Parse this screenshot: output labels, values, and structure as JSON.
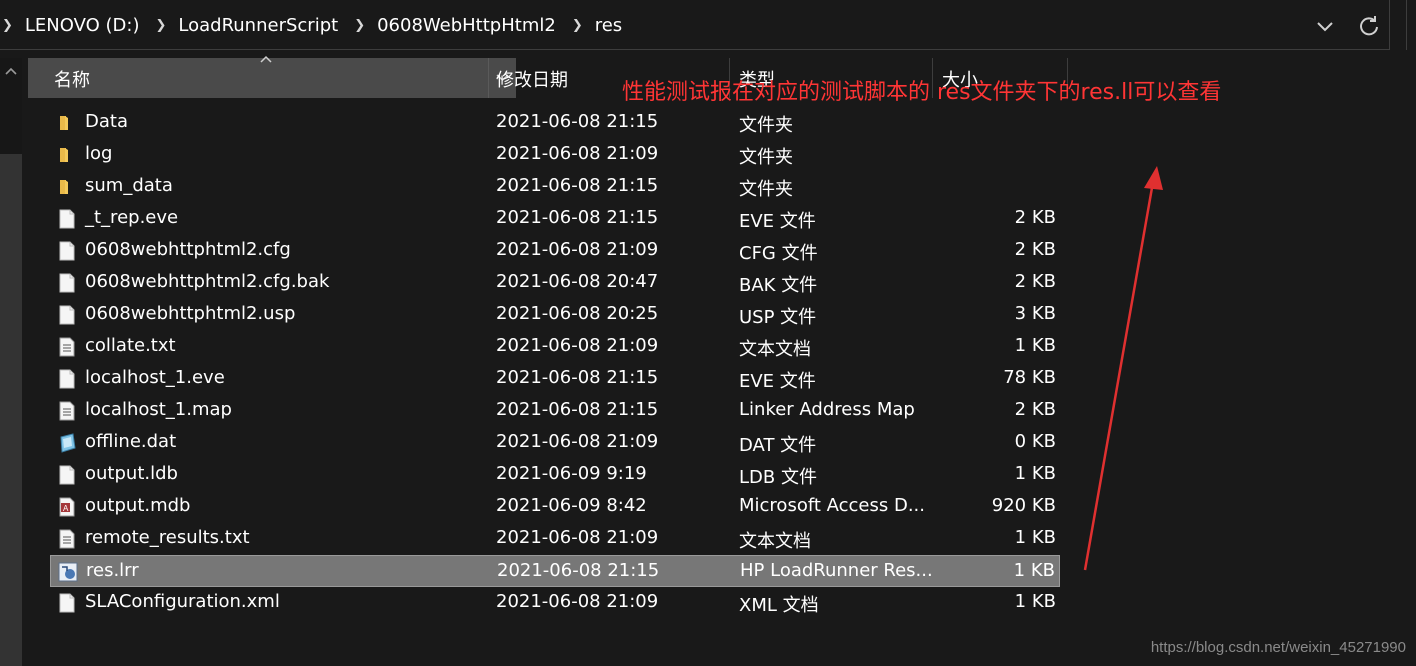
{
  "breadcrumb": [
    "LENOVO (D:)",
    "LoadRunnerScript",
    "0608WebHttpHtml2",
    "res"
  ],
  "columns": {
    "name": "名称",
    "date": "修改日期",
    "type": "类型",
    "size": "大小"
  },
  "files": [
    {
      "name": "Data",
      "date": "2021-06-08 21:15",
      "type": "文件夹",
      "size": "",
      "icon": "folder-icon"
    },
    {
      "name": "log",
      "date": "2021-06-08 21:09",
      "type": "文件夹",
      "size": "",
      "icon": "folder-icon"
    },
    {
      "name": "sum_data",
      "date": "2021-06-08 21:15",
      "type": "文件夹",
      "size": "",
      "icon": "folder-icon"
    },
    {
      "name": "_t_rep.eve",
      "date": "2021-06-08 21:15",
      "type": "EVE 文件",
      "size": "2 KB",
      "icon": "file-icon"
    },
    {
      "name": "0608webhttphtml2.cfg",
      "date": "2021-06-08 21:09",
      "type": "CFG 文件",
      "size": "2 KB",
      "icon": "file-icon"
    },
    {
      "name": "0608webhttphtml2.cfg.bak",
      "date": "2021-06-08 20:47",
      "type": "BAK 文件",
      "size": "2 KB",
      "icon": "file-icon"
    },
    {
      "name": "0608webhttphtml2.usp",
      "date": "2021-06-08 20:25",
      "type": "USP 文件",
      "size": "3 KB",
      "icon": "file-icon"
    },
    {
      "name": "collate.txt",
      "date": "2021-06-08 21:09",
      "type": "文本文档",
      "size": "1 KB",
      "icon": "text-file-icon"
    },
    {
      "name": "localhost_1.eve",
      "date": "2021-06-08 21:15",
      "type": "EVE 文件",
      "size": "78 KB",
      "icon": "file-icon"
    },
    {
      "name": "localhost_1.map",
      "date": "2021-06-08 21:15",
      "type": "Linker Address Map",
      "size": "2 KB",
      "icon": "text-file-icon"
    },
    {
      "name": "offline.dat",
      "date": "2021-06-08 21:09",
      "type": "DAT 文件",
      "size": "0 KB",
      "icon": "dat-file-icon"
    },
    {
      "name": "output.ldb",
      "date": "2021-06-09 9:19",
      "type": "LDB 文件",
      "size": "1 KB",
      "icon": "file-icon"
    },
    {
      "name": "output.mdb",
      "date": "2021-06-09 8:42",
      "type": "Microsoft Access D...",
      "size": "920 KB",
      "icon": "access-db-icon"
    },
    {
      "name": "remote_results.txt",
      "date": "2021-06-08 21:09",
      "type": "文本文档",
      "size": "1 KB",
      "icon": "text-file-icon"
    },
    {
      "name": "res.lrr",
      "date": "2021-06-08 21:15",
      "type": "HP LoadRunner Res...",
      "size": "1 KB",
      "icon": "loadrunner-file-icon",
      "selected": true
    },
    {
      "name": "SLAConfiguration.xml",
      "date": "2021-06-08 21:09",
      "type": "XML 文档",
      "size": "1 KB",
      "icon": "file-icon"
    }
  ],
  "annotation": "性能测试报在对应的测试脚本的 res文件夹下的res.ll可以查看",
  "watermark": "https://blog.csdn.net/weixin_45271990",
  "colors": {
    "background": "#191919",
    "header": "#4a4a4a",
    "selected": "#777777",
    "annotation": "#ff3535"
  }
}
